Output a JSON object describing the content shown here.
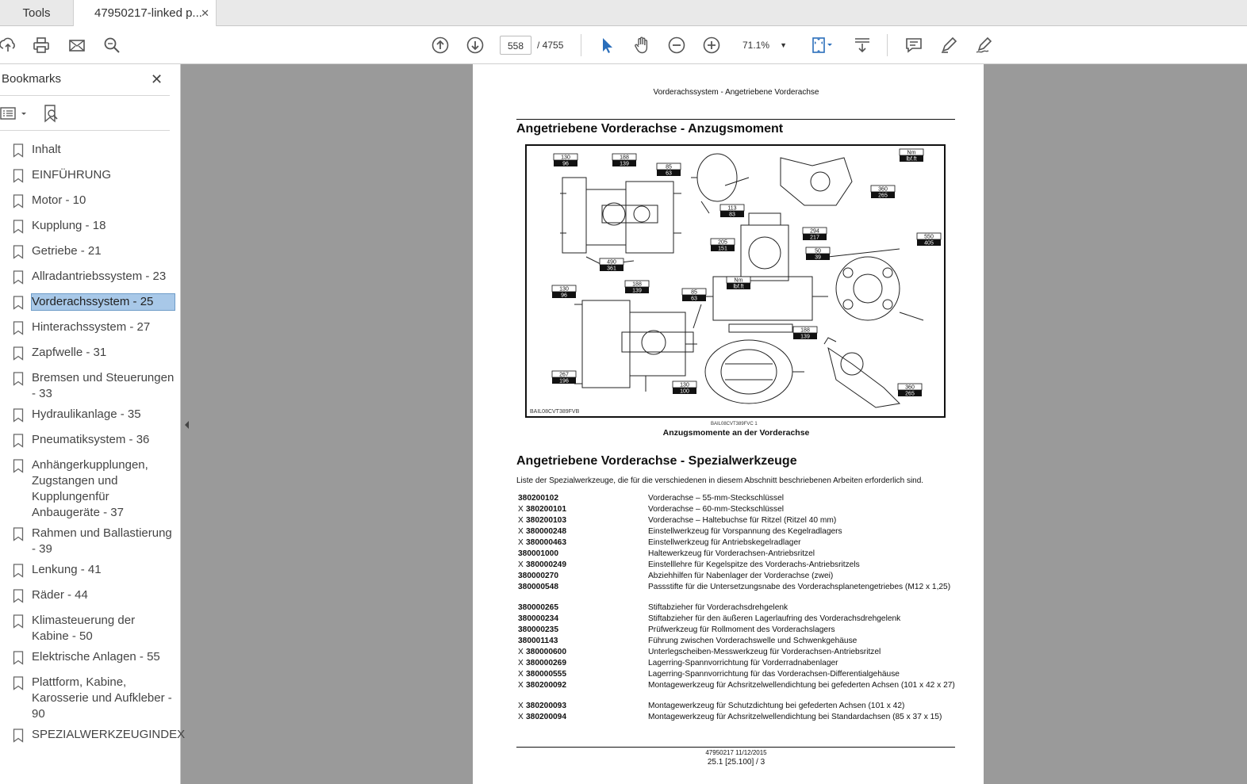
{
  "tabs": {
    "tools": "Tools",
    "document": "47950217-linked p..."
  },
  "toolbar": {
    "page_current": "558",
    "page_total": "/ 4755",
    "zoom": "71.1%"
  },
  "sidebar": {
    "title": "Bookmarks",
    "items": [
      {
        "label": "Inhalt"
      },
      {
        "label": "EINFÜHRUNG"
      },
      {
        "label": "Motor - 10"
      },
      {
        "label": "Kupplung - 18"
      },
      {
        "label": "Getriebe - 21"
      },
      {
        "label": "Allradantriebssystem - 23"
      },
      {
        "label": "Vorderachssystem - 25",
        "selected": true
      },
      {
        "label": "Hinterachssystem - 27"
      },
      {
        "label": "Zapfwelle - 31"
      },
      {
        "label": "Bremsen und Steuerungen - 33"
      },
      {
        "label": "Hydraulikanlage - 35"
      },
      {
        "label": "Pneumatiksystem - 36"
      },
      {
        "label": "Anhängerkupplungen, Zugstangen und Kupplungenfür Anbaugeräte - 37"
      },
      {
        "label": "Rahmen und Ballastierung - 39"
      },
      {
        "label": "Lenkung - 41"
      },
      {
        "label": "Räder - 44"
      },
      {
        "label": "Klimasteuerung der Kabine - 50"
      },
      {
        "label": "Elektrische Anlagen - 55"
      },
      {
        "label": "Plattform, Kabine, Karosserie und Aufkleber - 90"
      },
      {
        "label": "SPEZIALWERKZEUGINDEX"
      }
    ]
  },
  "page": {
    "header": "Vorderachssystem - Angetriebene Vorderachse",
    "section1_title": "Angetriebene Vorderachse - Anzugsmoment",
    "figure": {
      "id_bottom": "BAIL08CVT389FVB",
      "id_small": "BAIL08CVT389FVC    1",
      "caption": "Anzugsmomente an der Vorderachse",
      "legend_top": "Nm",
      "legend_bottom": "lbf.ft",
      "torque_labels": [
        {
          "nm": "130",
          "lbf": "96"
        },
        {
          "nm": "188",
          "lbf": "139"
        },
        {
          "nm": "85",
          "lbf": "63"
        },
        {
          "nm": "490",
          "lbf": "361"
        },
        {
          "nm": "113",
          "lbf": "83"
        },
        {
          "nm": "360",
          "lbf": "265"
        },
        {
          "nm": "294",
          "lbf": "217"
        },
        {
          "nm": "205",
          "lbf": "151"
        },
        {
          "nm": "50",
          "lbf": "39"
        },
        {
          "nm": "550",
          "lbf": "405"
        },
        {
          "nm": "130",
          "lbf": "96"
        },
        {
          "nm": "188",
          "lbf": "139"
        },
        {
          "nm": "85",
          "lbf": "63"
        },
        {
          "nm": "Nm",
          "lbf": "lbf.ft"
        },
        {
          "nm": "188",
          "lbf": "139"
        },
        {
          "nm": "267",
          "lbf": "196"
        },
        {
          "nm": "130",
          "lbf": "100"
        },
        {
          "nm": "360",
          "lbf": "265"
        }
      ]
    },
    "section2_title": "Angetriebene Vorderachse - Spezialwerkzeuge",
    "intro": "Liste der Spezialwerkzeuge, die für die verschiedenen in diesem Abschnitt beschriebenen Arbeiten erforderlich sind.",
    "tools": [
      {
        "x": "",
        "code": "380200102",
        "desc": "Vorderachse – 55-mm-Steckschlüssel"
      },
      {
        "x": "X",
        "code": "380200101",
        "desc": "Vorderachse – 60-mm-Steckschlüssel"
      },
      {
        "x": "X",
        "code": "380200103",
        "desc": "Vorderachse – Haltebuchse für Ritzel (Ritzel 40 mm)"
      },
      {
        "x": "X",
        "code": "380000248",
        "desc": "Einstellwerkzeug für Vorspannung des Kegelradlagers"
      },
      {
        "x": "X",
        "code": "380000463",
        "desc": "Einstellwerkzeug für Antriebskegelradlager"
      },
      {
        "x": "",
        "code": "380001000",
        "desc": "Haltewerkzeug für Vorderachsen-Antriebsritzel"
      },
      {
        "x": "X",
        "code": "380000249",
        "desc": "Einstelllehre für Kegelspitze des Vorderachs-Antriebsritzels"
      },
      {
        "x": "",
        "code": "380000270",
        "desc": "Abziehhilfen für Nabenlager der Vorderachse (zwei)"
      },
      {
        "x": "",
        "code": "380000548",
        "desc": "Passstifte für die Untersetzungsnabe des Vorderachsplanetengetriebes (M12 x 1,25)"
      },
      {
        "x": "",
        "code": "380000265",
        "desc": "Stiftabzieher für Vorderachsdrehgelenk"
      },
      {
        "x": "",
        "code": "380000234",
        "desc": "Stiftabzieher für den äußeren Lagerlaufring des Vorderachsdrehgelenk"
      },
      {
        "x": "",
        "code": "380000235",
        "desc": "Prüfwerkzeug für Rollmoment des Vorderachslagers"
      },
      {
        "x": "",
        "code": "380001143",
        "desc": "Führung zwischen Vorderachswelle und Schwenkgehäuse"
      },
      {
        "x": "X",
        "code": "380000600",
        "desc": "Unterlegscheiben-Messwerkzeug für Vorderachsen-Antriebsritzel"
      },
      {
        "x": "X",
        "code": "380000269",
        "desc": "Lagerring-Spannvorrichtung für Vorderradnabenlager"
      },
      {
        "x": "X",
        "code": "380000555",
        "desc": "Lagerring-Spannvorrichtung für das Vorderachsen-Differentialgehäuse"
      },
      {
        "x": "X",
        "code": "380200092",
        "desc": "Montagewerkzeug für Achsritzelwellendichtung bei gefederten Achsen (101 x 42 x 27)"
      },
      {
        "x": "X",
        "code": "380200093",
        "desc": "Montagewerkzeug für Schutzdichtung bei gefederten Achsen (101 x 42)"
      },
      {
        "x": "X",
        "code": "380200094",
        "desc": "Montagewerkzeug für Achsritzelwellendichtung bei Standardachsen (85 x 37 x 15)"
      }
    ],
    "footer_line1": "47950217 11/12/2015",
    "footer_line2": "25.1 [25.100] / 3"
  }
}
